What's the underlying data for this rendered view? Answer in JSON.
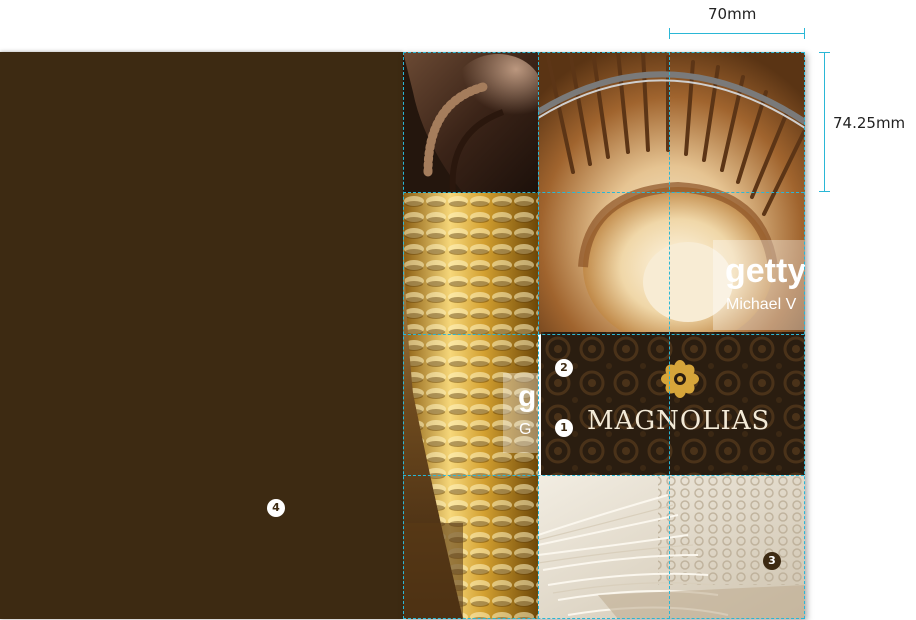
{
  "dimensions": {
    "width_label": "70mm",
    "height_label": "74.25mm"
  },
  "brand": {
    "name": "MAGNOLIAS",
    "logo_icon": "magnolia-flower-icon"
  },
  "watermarks": {
    "stairs_main": "getty",
    "stairs_sub": "Michael V",
    "vase_main": "g",
    "vase_sub": "G"
  },
  "callouts": {
    "brand_name": "1",
    "logo": "2",
    "fabric_photo": "3",
    "back_panel": "4"
  },
  "colors": {
    "panel_brown": "#3d2a12",
    "brand_bg": "#2a1d10",
    "gold": "#d6a53a",
    "guide_blue": "#2ab7d6"
  }
}
